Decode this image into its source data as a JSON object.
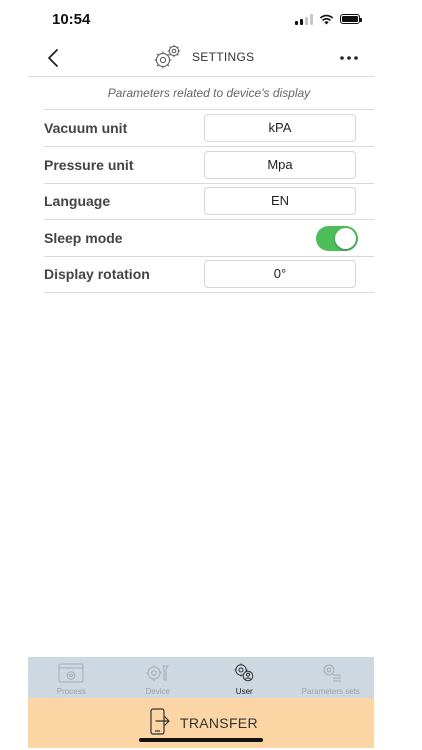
{
  "status_bar": {
    "time": "10:54"
  },
  "header": {
    "title": "SETTINGS",
    "icons": {
      "back": "chevron-left-icon",
      "title": "gears-icon",
      "more": "more-dots-icon"
    }
  },
  "subtitle": "Parameters related to device's display",
  "settings": [
    {
      "label": "Vacuum unit",
      "value": "kPA"
    },
    {
      "label": "Pressure unit",
      "value": "Mpa"
    },
    {
      "label": "Language",
      "value": "EN"
    },
    {
      "label": "Sleep mode",
      "toggle_on": true
    },
    {
      "label": "Display rotation",
      "value": "0°"
    }
  ],
  "tabs": [
    {
      "label": "Process",
      "icon": "process-icon",
      "active": false
    },
    {
      "label": "Device",
      "icon": "device-tools-icon",
      "active": false
    },
    {
      "label": "User",
      "icon": "user-gear-icon",
      "active": true
    },
    {
      "label": "Parameters sets",
      "icon": "parameters-sets-icon",
      "active": false
    }
  ],
  "transfer": {
    "label": "TRANSFER",
    "icon": "phone-transfer-icon"
  },
  "colors": {
    "toggle_on": "#4cbd58",
    "tabbar_bg": "#ced8e1",
    "transfer_bg": "#fbd5a3"
  }
}
